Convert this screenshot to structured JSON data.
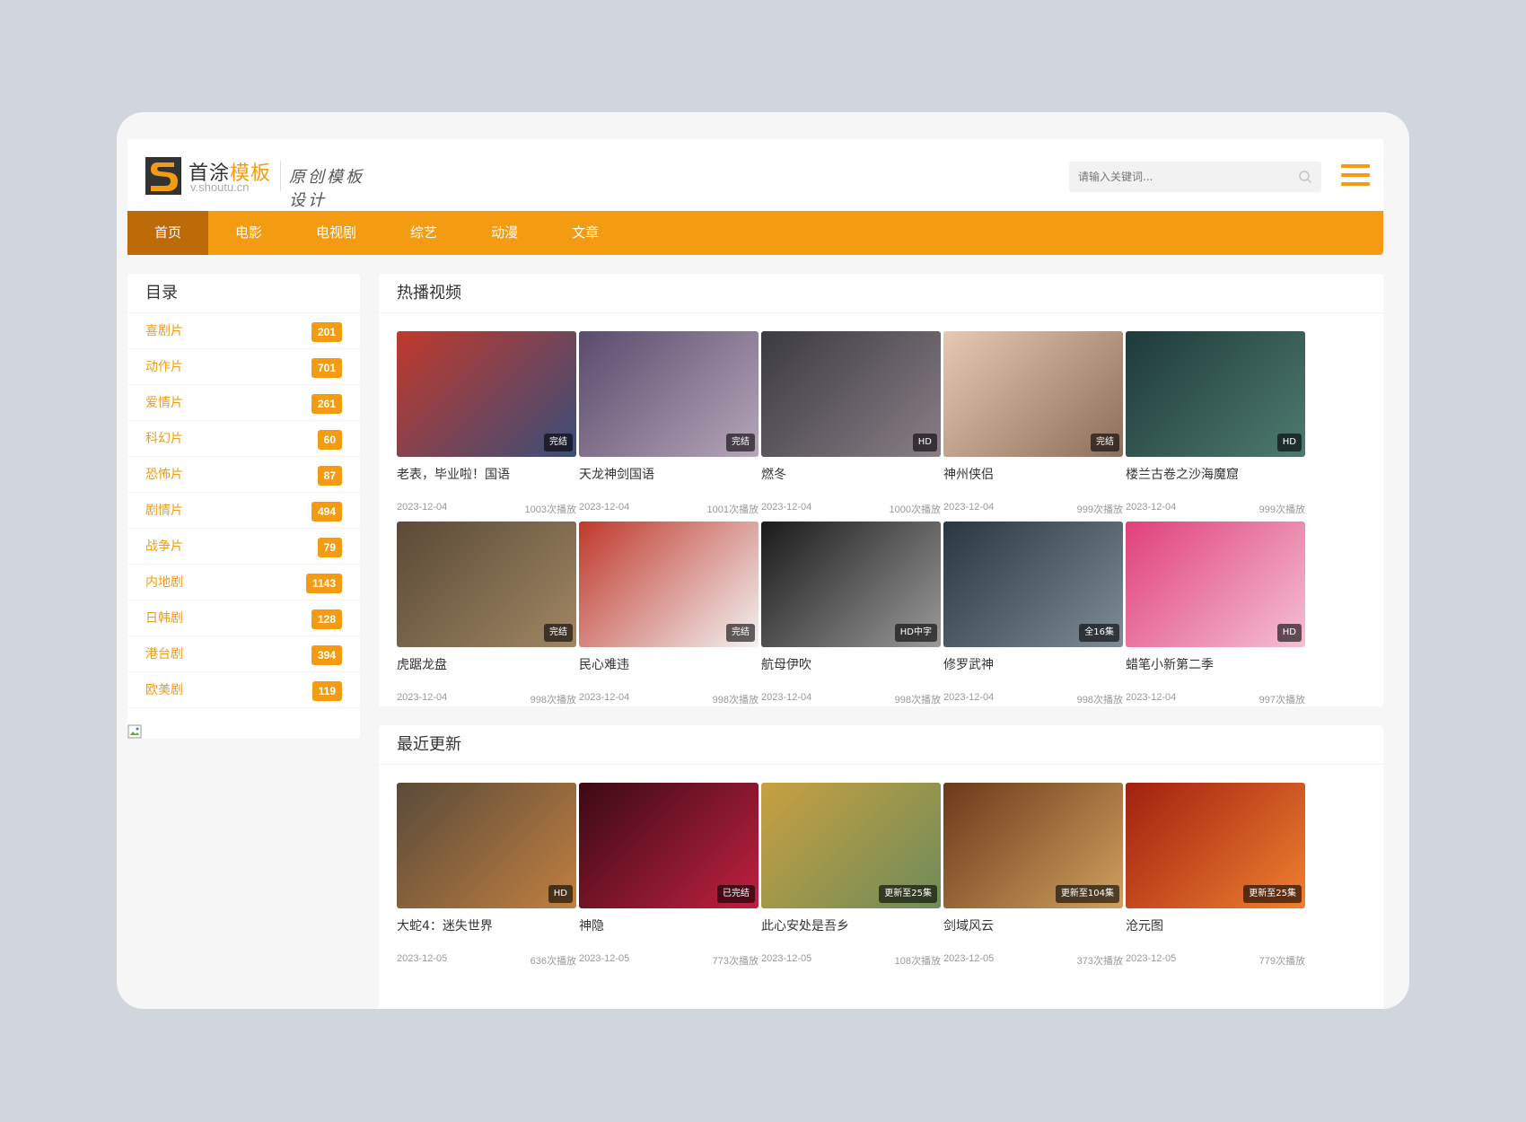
{
  "brand": {
    "name_part1": "首涂",
    "name_part2": "模板",
    "url": "v.shoutu.cn",
    "slogan": "原创模板设计"
  },
  "search": {
    "placeholder": "请输入关键词..."
  },
  "nav": [
    "首页",
    "电影",
    "电视剧",
    "综艺",
    "动漫",
    "文章"
  ],
  "sidebar": {
    "title": "目录",
    "items": [
      {
        "label": "喜剧片",
        "count": "201"
      },
      {
        "label": "动作片",
        "count": "701"
      },
      {
        "label": "爱情片",
        "count": "261"
      },
      {
        "label": "科幻片",
        "count": "60"
      },
      {
        "label": "恐怖片",
        "count": "87"
      },
      {
        "label": "剧情片",
        "count": "494"
      },
      {
        "label": "战争片",
        "count": "79"
      },
      {
        "label": "内地剧",
        "count": "1143"
      },
      {
        "label": "日韩剧",
        "count": "128"
      },
      {
        "label": "港台剧",
        "count": "394"
      },
      {
        "label": "欧美剧",
        "count": "119"
      }
    ]
  },
  "hot": {
    "title": "热播视频",
    "items": [
      {
        "title": "老表，毕业啦！国语",
        "badge": "完结",
        "date": "2023-12-04",
        "plays": "1003次播放",
        "c1": "#c0392b",
        "c2": "#3a4e7a"
      },
      {
        "title": "天龙神剑国语",
        "badge": "完结",
        "date": "2023-12-04",
        "plays": "1001次播放",
        "c1": "#5a4a6e",
        "c2": "#b6a6b8"
      },
      {
        "title": "燃冬",
        "badge": "HD",
        "date": "2023-12-04",
        "plays": "1000次播放",
        "c1": "#3a3a40",
        "c2": "#8a7e86"
      },
      {
        "title": "神州侠侣",
        "badge": "完结",
        "date": "2023-12-04",
        "plays": "999次播放",
        "c1": "#e6c8b4",
        "c2": "#8c6e5a"
      },
      {
        "title": "楼兰古卷之沙海魔窟",
        "badge": "HD",
        "date": "2023-12-04",
        "plays": "999次播放",
        "c1": "#1e3a3a",
        "c2": "#4e7a6e"
      },
      {
        "title": "虎踞龙盘",
        "badge": "完结",
        "date": "2023-12-04",
        "plays": "998次播放",
        "c1": "#5a4a36",
        "c2": "#a08664"
      },
      {
        "title": "民心难违",
        "badge": "完结",
        "date": "2023-12-04",
        "plays": "998次播放",
        "c1": "#c0392b",
        "c2": "#f2f2f2"
      },
      {
        "title": "航母伊吹",
        "badge": "HD中字",
        "date": "2023-12-04",
        "plays": "998次播放",
        "c1": "#1a1a1a",
        "c2": "#9a9a9a"
      },
      {
        "title": "修罗武神",
        "badge": "全16集",
        "date": "2023-12-04",
        "plays": "998次播放",
        "c1": "#2a3640",
        "c2": "#7e8c96"
      },
      {
        "title": "蜡笔小新第二季",
        "badge": "HD",
        "date": "2023-12-04",
        "plays": "997次播放",
        "c1": "#e0407a",
        "c2": "#f4c0d4"
      }
    ]
  },
  "recent": {
    "title": "最近更新",
    "items": [
      {
        "title": "大蛇4：迷失世界",
        "badge": "HD",
        "date": "2023-12-05",
        "plays": "636次播放",
        "c1": "#5a4a3a",
        "c2": "#c08040"
      },
      {
        "title": "神隐",
        "badge": "已完结",
        "date": "2023-12-05",
        "plays": "773次播放",
        "c1": "#3a0a14",
        "c2": "#c02040"
      },
      {
        "title": "此心安处是吾乡",
        "badge": "更新至25集",
        "date": "2023-12-05",
        "plays": "108次播放",
        "c1": "#c8a040",
        "c2": "#6e8c5a"
      },
      {
        "title": "剑域风云",
        "badge": "更新至104集",
        "date": "2023-12-05",
        "plays": "373次播放",
        "c1": "#6a3a1a",
        "c2": "#d0a060"
      },
      {
        "title": "沧元图",
        "badge": "更新至25集",
        "date": "2023-12-05",
        "plays": "779次播放",
        "c1": "#a02010",
        "c2": "#f08030"
      }
    ]
  }
}
